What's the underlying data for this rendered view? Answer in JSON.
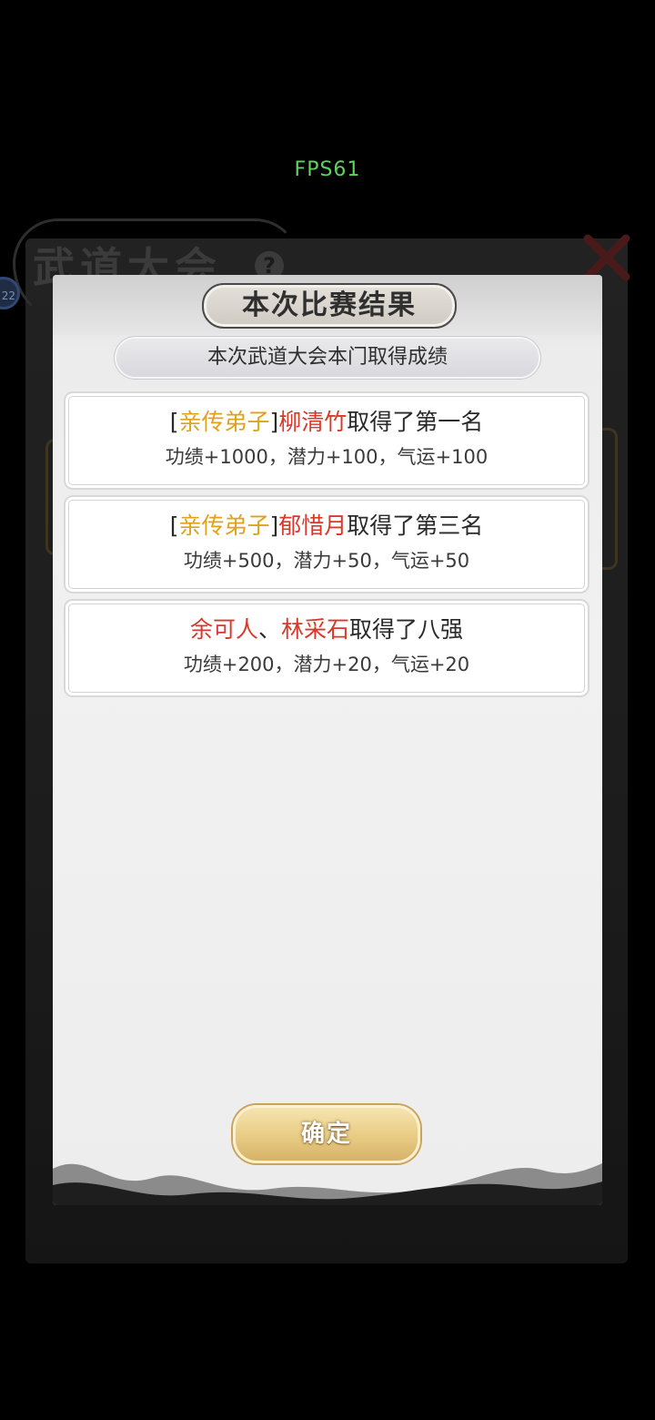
{
  "overlay": {
    "fps": "FPS61"
  },
  "background": {
    "title": "武道大会",
    "help_glyph": "?",
    "avatar_level": "22"
  },
  "modal": {
    "title": "本次比赛结果",
    "subtitle": "本次武道大会本门取得成绩",
    "results": [
      {
        "bracket_open": "[",
        "role": "亲传弟子",
        "bracket_close": "]",
        "name": "柳清竹",
        "achievement": "取得了第一名",
        "rewards": "功绩+1000，潜力+100，气运+100"
      },
      {
        "bracket_open": "[",
        "role": "亲传弟子",
        "bracket_close": "]",
        "name": "郁惜月",
        "achievement": "取得了第三名",
        "rewards": "功绩+500，潜力+50，气运+50"
      },
      {
        "names_a": "余可人",
        "separator": "、",
        "names_b": "林采石",
        "achievement": "取得了八强",
        "rewards": "功绩+200，潜力+20，气运+20"
      }
    ],
    "confirm_label": "确定"
  },
  "colors": {
    "role_gold": "#e0a21a",
    "name_red": "#d8392a",
    "fps_green": "#5fd35f",
    "button_gold": "#e8cb83"
  }
}
